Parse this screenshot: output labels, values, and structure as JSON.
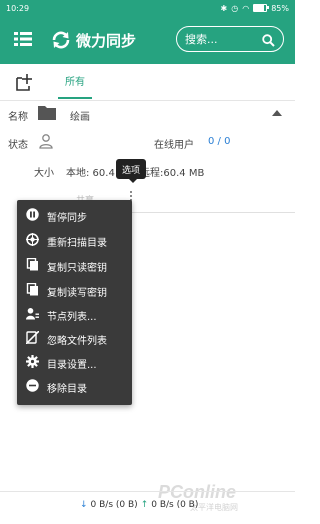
{
  "status_bar": {
    "time": "10:29",
    "battery": "85%",
    "battery_level": 0.85
  },
  "app_bar": {
    "title": "微力同步",
    "search_placeholder": "搜索..."
  },
  "tabs": [
    {
      "label": "所有",
      "active": true
    }
  ],
  "folder": {
    "name_label": "名称",
    "name": "绘画",
    "status_label": "状态",
    "online_label": "在线用户",
    "online_value": "0 / 0",
    "size_label": "大小",
    "size_local": "本地: 60.4 MB",
    "size_remote": "远程:60.4 MB",
    "share_hint": "共享"
  },
  "tooltip": "选项",
  "menu": {
    "items": [
      {
        "label": "暂停同步",
        "icon": "pause-icon"
      },
      {
        "label": "重新扫描目录",
        "icon": "rescan-icon"
      },
      {
        "label": "复制只读密钥",
        "icon": "copy-icon"
      },
      {
        "label": "复制读写密钥",
        "icon": "copy-icon"
      },
      {
        "label": "节点列表...",
        "icon": "nodes-icon"
      },
      {
        "label": "忽略文件列表",
        "icon": "ignore-icon"
      },
      {
        "label": "目录设置...",
        "icon": "gear-icon"
      },
      {
        "label": "移除目录",
        "icon": "remove-icon"
      }
    ]
  },
  "footer": {
    "down": "0 B/s (0 B)",
    "up": "0 B/s (0 B)"
  },
  "watermark": {
    "brand": "PConline",
    "sub": "太平洋电脑网"
  },
  "colors": {
    "primary": "#26a380",
    "link": "#2a7fd4",
    "menu_bg": "#3a3a3a"
  }
}
